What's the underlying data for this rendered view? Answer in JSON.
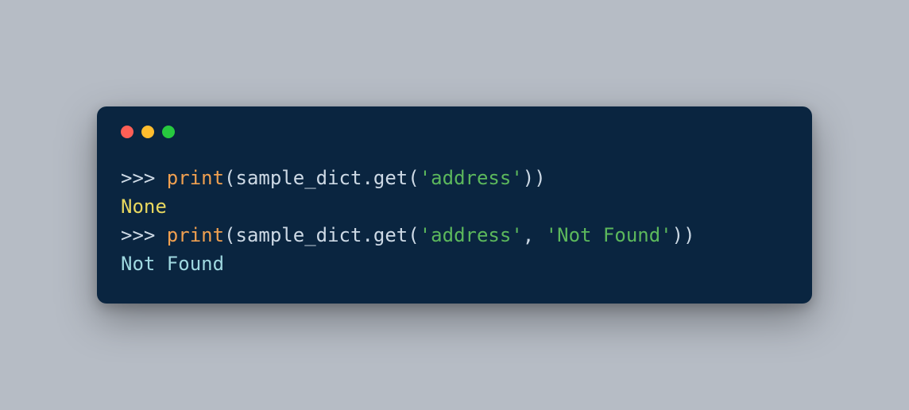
{
  "window": {
    "lights": [
      "red",
      "yellow",
      "green"
    ]
  },
  "code": {
    "line1": {
      "prompt": ">>> ",
      "func": "print",
      "open1": "(",
      "ident": "sample_dict",
      "dot": ".",
      "method": "get",
      "open2": "(",
      "str1": "'address'",
      "close2": ")",
      "close1": ")"
    },
    "line2": {
      "output": "None"
    },
    "line3": {
      "prompt": ">>> ",
      "func": "print",
      "open1": "(",
      "ident": "sample_dict",
      "dot": ".",
      "method": "get",
      "open2": "(",
      "str1": "'address'",
      "comma": ", ",
      "str2": "'Not Found'",
      "close2": ")",
      "close1": ")"
    },
    "line4": {
      "output": "Not Found"
    }
  }
}
